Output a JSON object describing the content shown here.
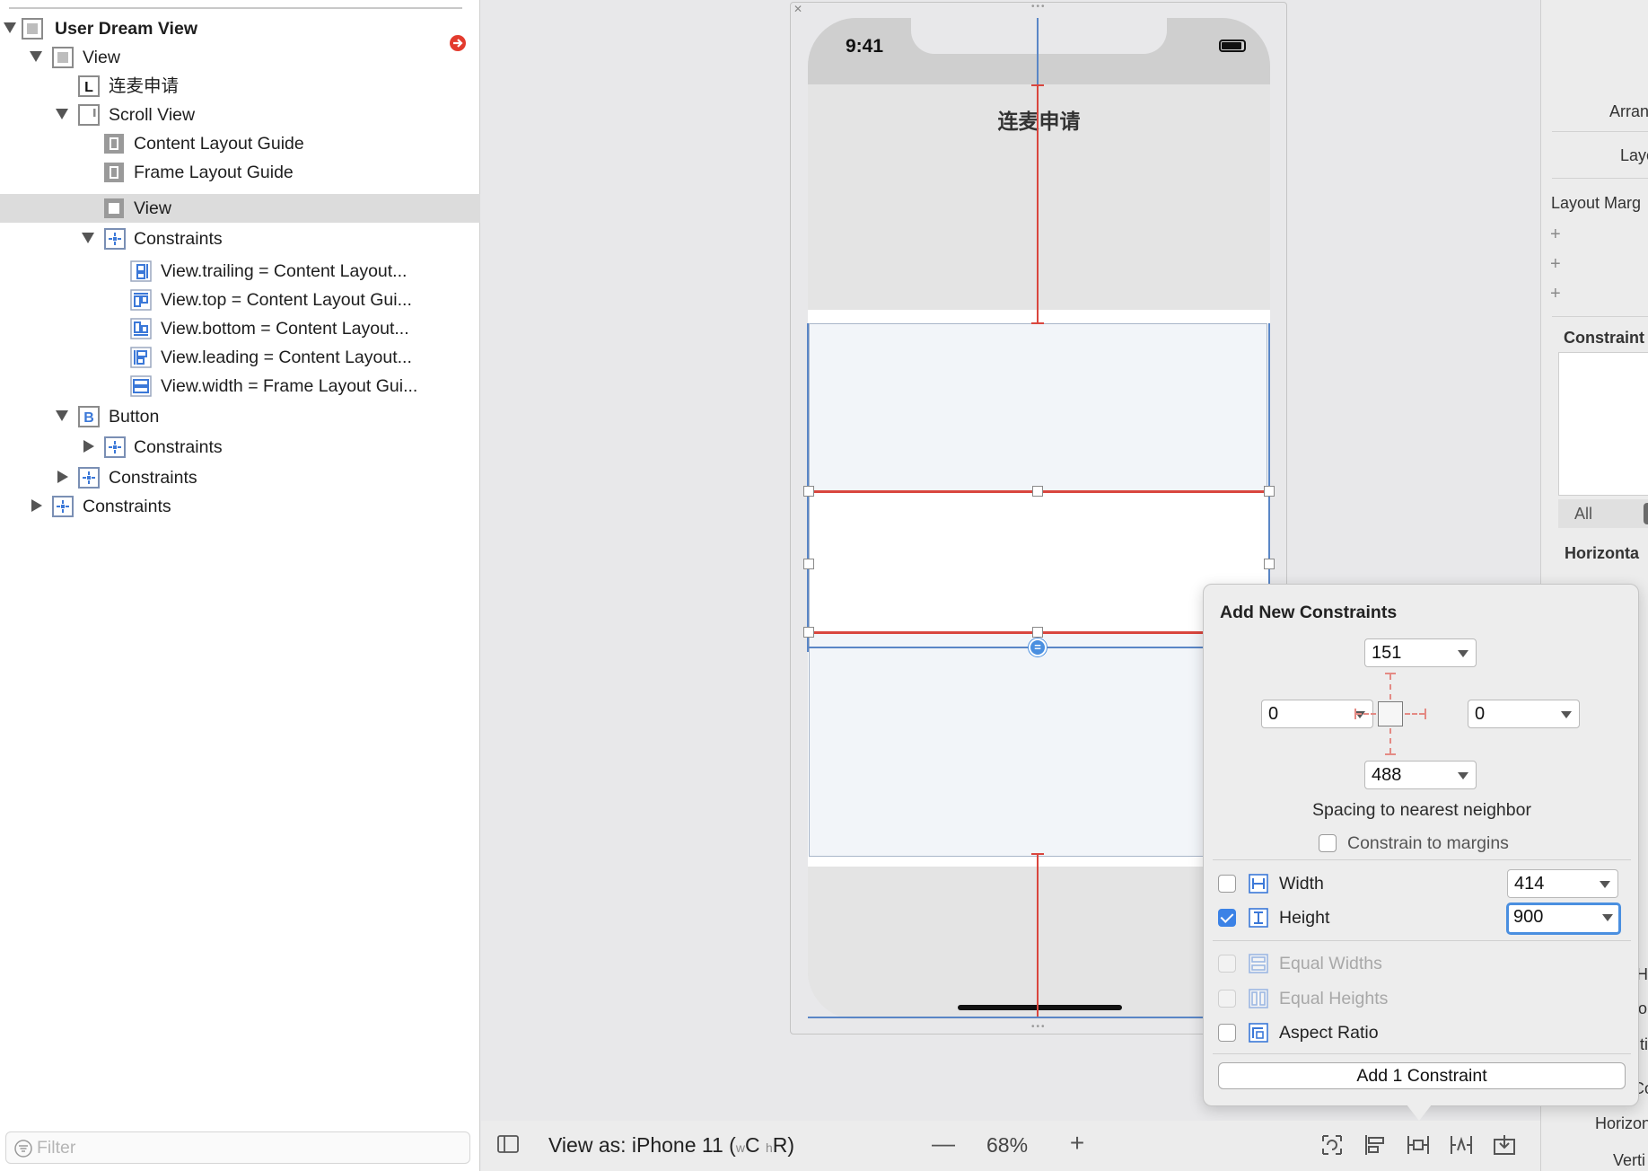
{
  "outline": {
    "items": [
      {
        "label": "User Dream View",
        "bold": true
      },
      {
        "label": "View"
      },
      {
        "label": "连麦申请"
      },
      {
        "label": "Scroll View"
      },
      {
        "label": "Content Layout Guide"
      },
      {
        "label": "Frame Layout Guide"
      },
      {
        "label": "View"
      },
      {
        "label": "Constraints"
      },
      {
        "label": "View.trailing = Content Layout..."
      },
      {
        "label": "View.top = Content Layout Gui..."
      },
      {
        "label": "View.bottom = Content Layout..."
      },
      {
        "label": "View.leading = Content Layout..."
      },
      {
        "label": "View.width = Frame Layout Gui..."
      },
      {
        "label": "Button"
      },
      {
        "label": "Constraints"
      },
      {
        "label": "Constraints"
      },
      {
        "label": "Constraints"
      }
    ],
    "label_glyph": "L",
    "button_glyph": "B",
    "filter_placeholder": "Filter"
  },
  "device": {
    "time": "9:41",
    "title": "连麦申请"
  },
  "popover": {
    "title": "Add New Constraints",
    "top": "151",
    "left": "0",
    "right": "0",
    "bottom": "488",
    "spacing_label": "Spacing to nearest neighbor",
    "constrain_margins": "Constrain to margins",
    "width_label": "Width",
    "width_value": "414",
    "height_label": "Height",
    "height_value": "900",
    "equal_widths": "Equal Widths",
    "equal_heights": "Equal Heights",
    "aspect_ratio": "Aspect Ratio",
    "add_button": "Add 1 Constraint"
  },
  "inspector": {
    "arrange": "Arran",
    "layout": "Layo",
    "layout_margins": "Layout Marg",
    "constraints": "Constraint",
    "seg_all": "All",
    "seg_t": "T",
    "horizontal": "Horizonta",
    "frag_hu": "Hu",
    "frag_or": "or",
    "frag_ti": "ti",
    "frag_co": "Co",
    "horizon": "Horizon",
    "verti": "Verti"
  },
  "bottombar": {
    "view_as_prefix": "View as: iPhone 11 (",
    "w": "w",
    "c": "C",
    "h": "h",
    "r": "R",
    "close_paren": ")",
    "minus": "—",
    "zoom": "68%",
    "plus": "+"
  },
  "colors": {
    "constraint_red": "#d9463e",
    "selection_blue": "#5a86c6",
    "accent": "#3b82e6"
  }
}
